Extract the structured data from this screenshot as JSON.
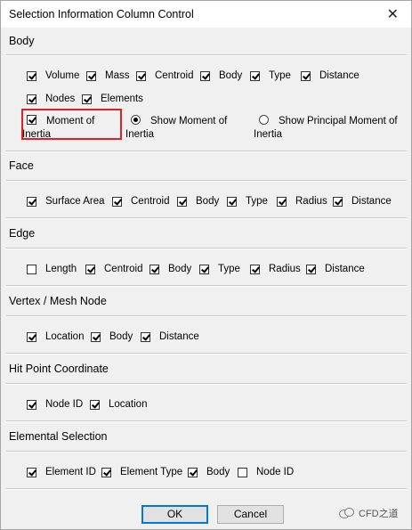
{
  "window": {
    "title": "Selection Information Column Control",
    "close_glyph": "✕"
  },
  "body_section": {
    "label": "Body",
    "checkboxes": [
      {
        "label": "Volume",
        "checked": true
      },
      {
        "label": "Mass",
        "checked": true
      },
      {
        "label": "Centroid",
        "checked": true
      },
      {
        "label": "Body",
        "checked": true
      },
      {
        "label": "Type",
        "checked": true
      },
      {
        "label": "Distance",
        "checked": true
      },
      {
        "label": "Nodes",
        "checked": true
      },
      {
        "label": "Elements",
        "checked": true
      }
    ],
    "moment": {
      "line1": "Moment of",
      "line2": "Inertia",
      "checked": true
    },
    "radio_show_moment": {
      "line1": "Show Moment of",
      "line2": "Inertia",
      "selected": true
    },
    "radio_show_principal": {
      "line1": "Show Principal Moment of",
      "line2": "Inertia",
      "selected": false
    }
  },
  "face_section": {
    "label": "Face",
    "checkboxes": [
      {
        "label": "Surface Area",
        "checked": true
      },
      {
        "label": "Centroid",
        "checked": true
      },
      {
        "label": "Body",
        "checked": true
      },
      {
        "label": "Type",
        "checked": true
      },
      {
        "label": "Radius",
        "checked": true
      },
      {
        "label": "Distance",
        "checked": true
      }
    ]
  },
  "edge_section": {
    "label": "Edge",
    "checkboxes": [
      {
        "label": "Length",
        "checked": false
      },
      {
        "label": "Centroid",
        "checked": true
      },
      {
        "label": "Body",
        "checked": true
      },
      {
        "label": "Type",
        "checked": true
      },
      {
        "label": "Radius",
        "checked": true
      },
      {
        "label": "Distance",
        "checked": true
      }
    ]
  },
  "vertex_section": {
    "label": "Vertex / Mesh Node",
    "checkboxes": [
      {
        "label": "Location",
        "checked": true
      },
      {
        "label": "Body",
        "checked": true
      },
      {
        "label": "Distance",
        "checked": true
      }
    ]
  },
  "hit_section": {
    "label": "Hit Point Coordinate",
    "checkboxes": [
      {
        "label": "Node ID",
        "checked": true
      },
      {
        "label": "Location",
        "checked": true
      }
    ]
  },
  "elemental_section": {
    "label": "Elemental Selection",
    "checkboxes": [
      {
        "label": "Element ID",
        "checked": true
      },
      {
        "label": "Element Type",
        "checked": true
      },
      {
        "label": "Body",
        "checked": true
      },
      {
        "label": "Node ID",
        "checked": false
      }
    ]
  },
  "buttons": {
    "ok": "OK",
    "cancel": "Cancel"
  },
  "watermark": {
    "text": "CFD之道"
  },
  "colors": {
    "highlight": "#e01f27",
    "default_button_border": "#0078d7"
  }
}
